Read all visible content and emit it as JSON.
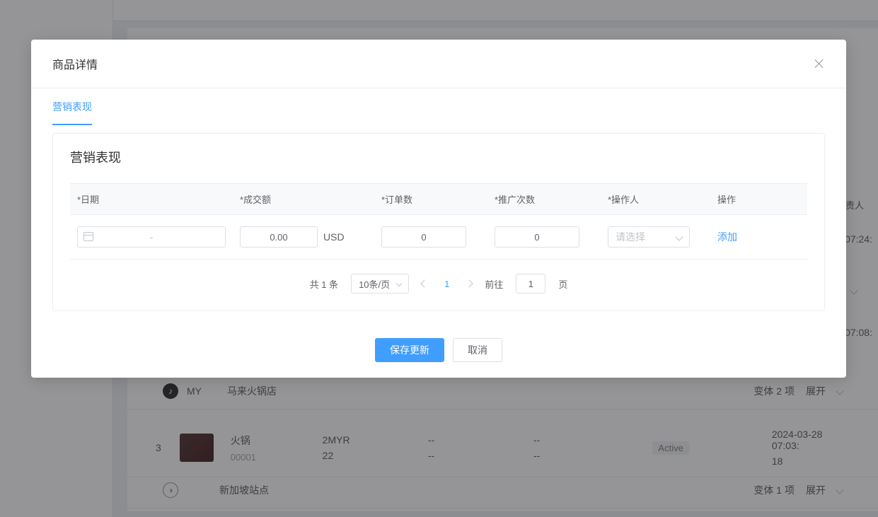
{
  "modal": {
    "title": "商品详情",
    "tab_marketing": "营销表现",
    "card_title": "营销表现",
    "columns": {
      "date": "*日期",
      "amount": "*成交额",
      "orders": "*订单数",
      "promo": "*推广次数",
      "operator": "*操作人",
      "action": "操作"
    },
    "row": {
      "date_sep": "-",
      "amount_value": "0.00",
      "currency": "USD",
      "orders_value": "0",
      "promo_value": "0",
      "operator_placeholder": "请选择",
      "action_add": "添加"
    },
    "pagination": {
      "total_text": "共 1 条",
      "page_size": "10条/页",
      "current": "1",
      "goto_prefix": "前往",
      "goto_value": "1",
      "goto_suffix": "页"
    },
    "footer": {
      "save": "保存更新",
      "cancel": "取消"
    }
  },
  "background": {
    "header_responsible": "负责人",
    "time1": "07:24:",
    "time2": "07:08:",
    "store3": {
      "code": "MY",
      "name": "马来火锅店",
      "variant_text": "变体 2 项",
      "expand": "展开"
    },
    "item3": {
      "index": "3",
      "name": "火锅",
      "sku": "00001",
      "price": "2MYR",
      "qty": "22",
      "dash": "--",
      "status": "Active",
      "time": "2024-03-28 07:03:",
      "count": "18"
    },
    "store4": {
      "name": "新加坡站点",
      "variant_text": "变体 1 项",
      "expand": "展开"
    }
  }
}
